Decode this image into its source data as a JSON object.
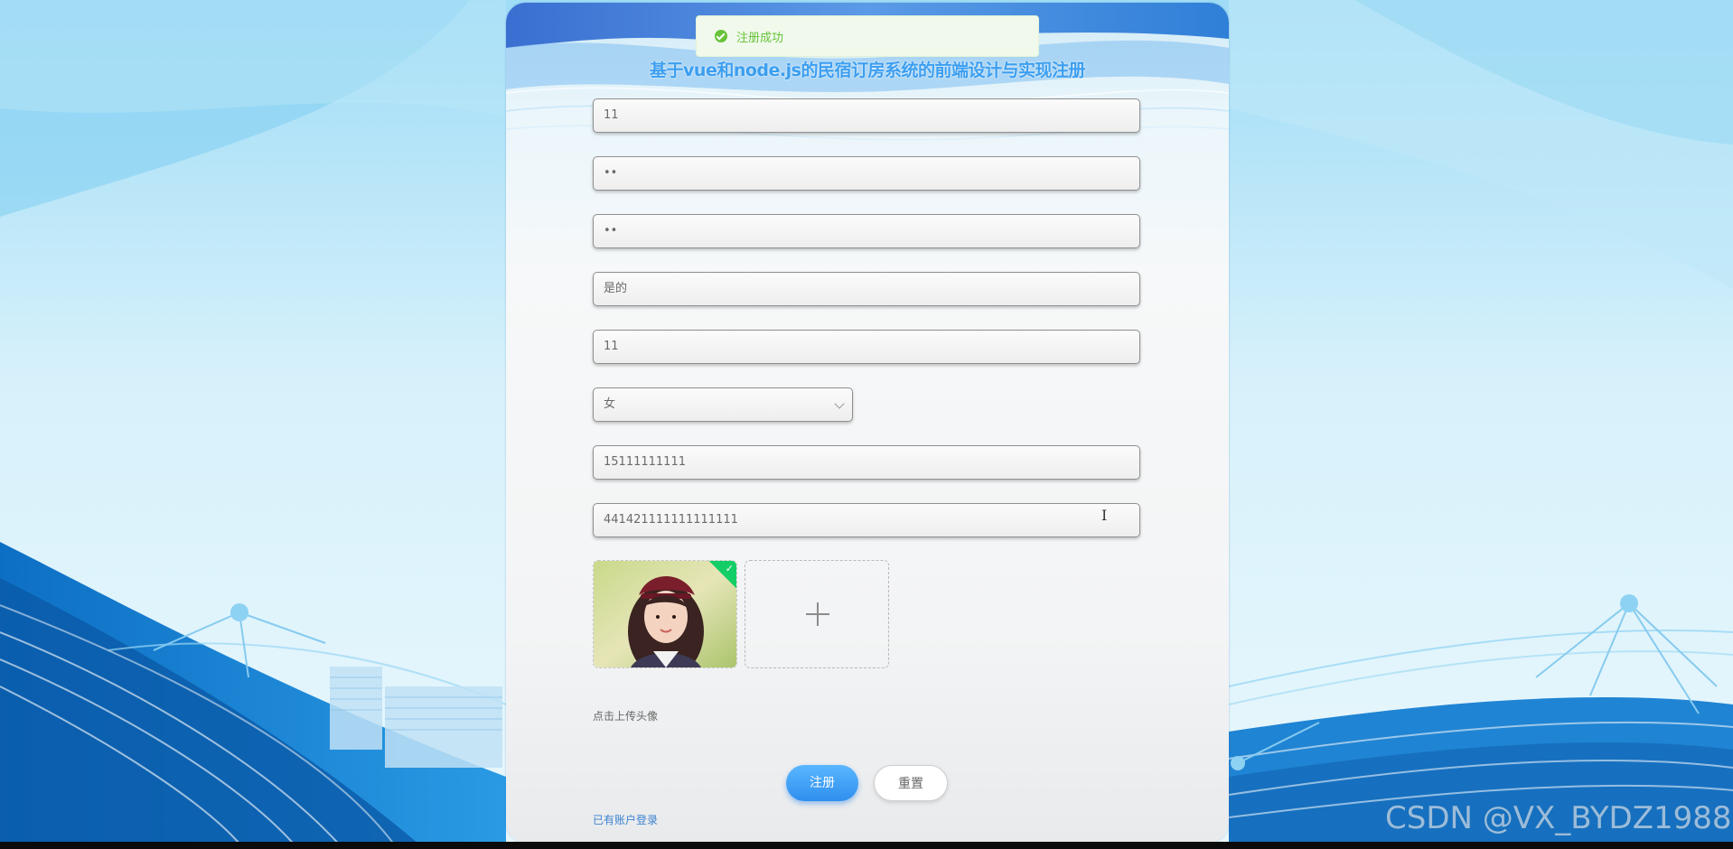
{
  "page": {
    "title": "基于vue和node.js的民宿订房系统的前端设计与实现注册"
  },
  "toast": {
    "message": "注册成功",
    "icon": "success-check-icon",
    "color": "#67c23a"
  },
  "form": {
    "fields": [
      {
        "name": "account",
        "value": "11"
      },
      {
        "name": "password",
        "value": "••"
      },
      {
        "name": "confirm_password",
        "value": "••"
      },
      {
        "name": "name",
        "value": "是的"
      },
      {
        "name": "age",
        "value": "11"
      },
      {
        "name": "gender",
        "value": "女"
      },
      {
        "name": "phone",
        "value": "15111111111"
      },
      {
        "name": "id_card",
        "value": "441421111111111111"
      }
    ],
    "upload_hint": "点击上传头像",
    "register_label": "注册",
    "reset_label": "重置",
    "login_link": "已有账户登录"
  },
  "watermark": "CSDN @VX_BYDZ1988",
  "colors": {
    "accent": "#3b9ef0",
    "button": "#2f8fee",
    "link": "#3b83d1"
  }
}
